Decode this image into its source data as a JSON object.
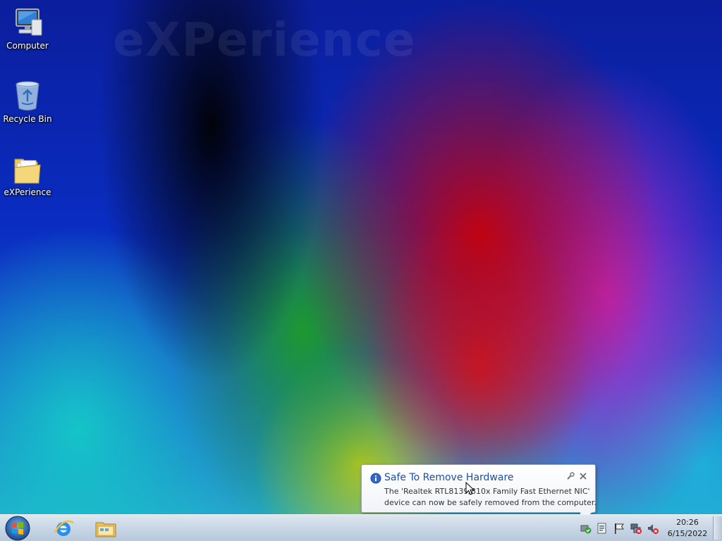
{
  "desktop": {
    "watermark_text": "eXPerience",
    "icons": [
      {
        "label": "Computer",
        "icon": "computer-icon"
      },
      {
        "label": "Recycle Bin",
        "icon": "recycle-bin-icon"
      },
      {
        "label": "eXPerience",
        "icon": "folder-icon"
      }
    ]
  },
  "balloon": {
    "title": "Safe To Remove Hardware",
    "line1": "The 'Realtek RTL8139/810x Family Fast Ethernet NIC'",
    "line2": "device can now be safely removed from the computer.",
    "icon": "info-icon"
  },
  "taskbar": {
    "start_icon": "windows-logo-icon",
    "pinned": [
      {
        "name": "internet-explorer",
        "icon": "internet-explorer-icon"
      },
      {
        "name": "windows-explorer",
        "icon": "windows-explorer-icon"
      }
    ],
    "tray_icons": [
      "safely-remove-hardware-icon",
      "document-icon",
      "action-center-flag-icon",
      "network-disconnected-icon",
      "volume-muted-icon"
    ],
    "clock": {
      "time": "20:26",
      "date": "6/15/2022"
    }
  },
  "colors": {
    "taskbar_top": "#dfe7f0",
    "balloon_title": "#1c4fa8",
    "desktop_base": "#0b1e9c"
  }
}
